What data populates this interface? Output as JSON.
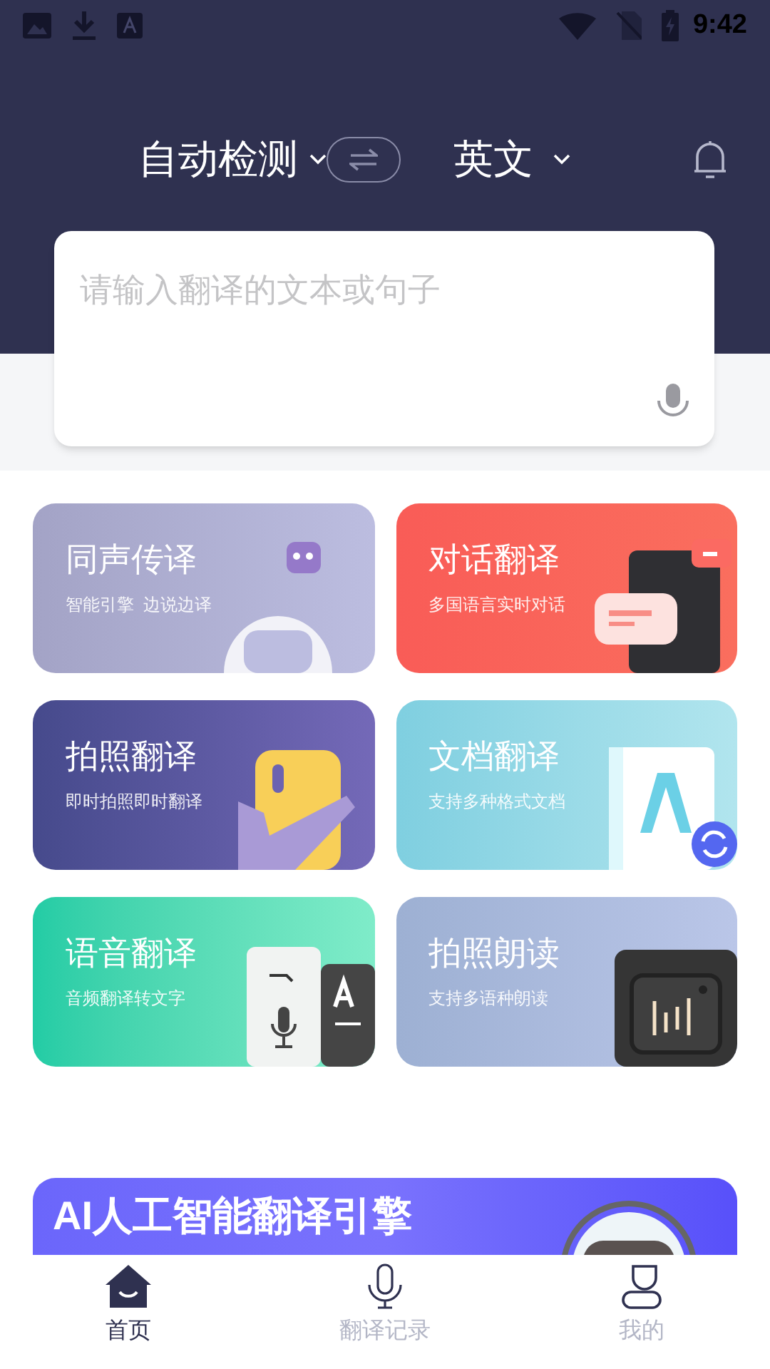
{
  "status_bar": {
    "time": "9:42"
  },
  "header": {
    "source_language": "自动检测",
    "target_language": "英文"
  },
  "input": {
    "placeholder": "请输入翻译的文本或句子"
  },
  "features": [
    {
      "kind": "simultaneous",
      "title": "同声传译",
      "subtitle": "智能引擎  边说边译"
    },
    {
      "kind": "dialogue",
      "title": "对话翻译",
      "subtitle": "多国语言实时对话"
    },
    {
      "kind": "photo",
      "title": "拍照翻译",
      "subtitle": "即时拍照即时翻译"
    },
    {
      "kind": "document",
      "title": "文档翻译",
      "subtitle": "支持多种格式文档"
    },
    {
      "kind": "voice",
      "title": "语音翻译",
      "subtitle": "音频翻译转文字"
    },
    {
      "kind": "read",
      "title": "拍照朗读",
      "subtitle": "支持多语种朗读"
    }
  ],
  "banner": {
    "title": "AI人工智能翻译引擎"
  },
  "bottom_nav": [
    {
      "label": "首页",
      "selected": true
    },
    {
      "label": "翻译记录",
      "selected": false
    },
    {
      "label": "我的",
      "selected": false
    }
  ]
}
